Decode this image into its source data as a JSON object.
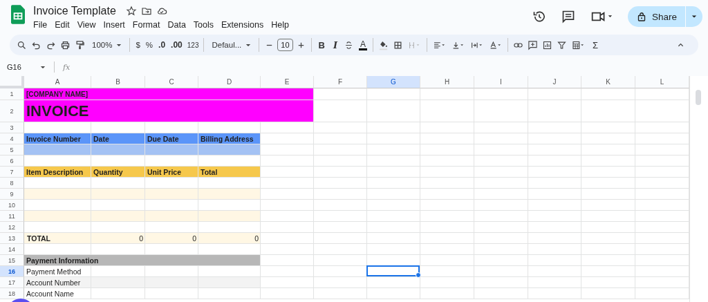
{
  "document": {
    "title": "Invoice Template"
  },
  "menu": [
    "File",
    "Edit",
    "View",
    "Insert",
    "Format",
    "Data",
    "Tools",
    "Extensions",
    "Help"
  ],
  "share_button": {
    "label": "Share"
  },
  "toolbar": {
    "zoom": "100%",
    "currency": "$",
    "percent": "%",
    "decrease_decimals": ".0",
    "increase_decimals": ".00",
    "number_format": "123",
    "font": "Defaul...",
    "font_size": "10",
    "bold": "B",
    "italic": "I",
    "text_color": "A",
    "functions": "Σ"
  },
  "formula_bar": {
    "cell_reference": "G16",
    "fx": "fx"
  },
  "columns": [
    {
      "label": "A",
      "selected": false
    },
    {
      "label": "B",
      "selected": false
    },
    {
      "label": "C",
      "selected": false
    },
    {
      "label": "D",
      "selected": false
    },
    {
      "label": "E",
      "selected": false
    },
    {
      "label": "F",
      "selected": false
    },
    {
      "label": "G",
      "selected": true
    },
    {
      "label": "H",
      "selected": false
    },
    {
      "label": "I",
      "selected": false
    },
    {
      "label": "J",
      "selected": false
    },
    {
      "label": "K",
      "selected": false
    },
    {
      "label": "L",
      "selected": false
    }
  ],
  "rows": [
    {
      "number": "1",
      "selected": false,
      "kind": "company",
      "color": "#ff00ff",
      "cells": [
        "[COMPANY NAME]"
      ]
    },
    {
      "number": "2",
      "selected": false,
      "kind": "title",
      "color": "#ff00ff",
      "cells": [
        "INVOICE"
      ]
    },
    {
      "number": "3",
      "selected": false,
      "kind": "blank"
    },
    {
      "number": "4",
      "selected": false,
      "kind": "header",
      "color": "#5b95f9",
      "cells": [
        "Invoice Number",
        "Date",
        "Due Date",
        "Billing Address"
      ]
    },
    {
      "number": "5",
      "selected": false,
      "kind": "band",
      "color": "#a4c2f4"
    },
    {
      "number": "6",
      "selected": false,
      "kind": "blank"
    },
    {
      "number": "7",
      "selected": false,
      "kind": "header",
      "color": "#f6c84c",
      "cells": [
        "Item Description",
        "Quantity",
        "Unit Price",
        "Total"
      ]
    },
    {
      "number": "8",
      "selected": false,
      "kind": "blank"
    },
    {
      "number": "9",
      "selected": false,
      "kind": "band",
      "color": "#fff7e4"
    },
    {
      "number": "10",
      "selected": false,
      "kind": "blank"
    },
    {
      "number": "11",
      "selected": false,
      "kind": "band",
      "color": "#fff7e4"
    },
    {
      "number": "12",
      "selected": false,
      "kind": "blank"
    },
    {
      "number": "13",
      "selected": false,
      "kind": "total",
      "color": "#fff7e4",
      "cells": [
        "TOTAL",
        "0",
        "0",
        "0"
      ]
    },
    {
      "number": "14",
      "selected": false,
      "kind": "blank"
    },
    {
      "number": "15",
      "selected": false,
      "kind": "section",
      "color": "#b7b7b7",
      "cells": [
        "Payment Information"
      ]
    },
    {
      "number": "16",
      "selected": true,
      "kind": "field",
      "color": "#ffffff",
      "cells": [
        "Payment Method"
      ]
    },
    {
      "number": "17",
      "selected": false,
      "kind": "field",
      "color": "#f3f3f3",
      "cells": [
        "Account Number"
      ]
    },
    {
      "number": "18",
      "selected": false,
      "kind": "field",
      "color": "#ffffff",
      "cells": [
        "Account Name"
      ]
    }
  ]
}
